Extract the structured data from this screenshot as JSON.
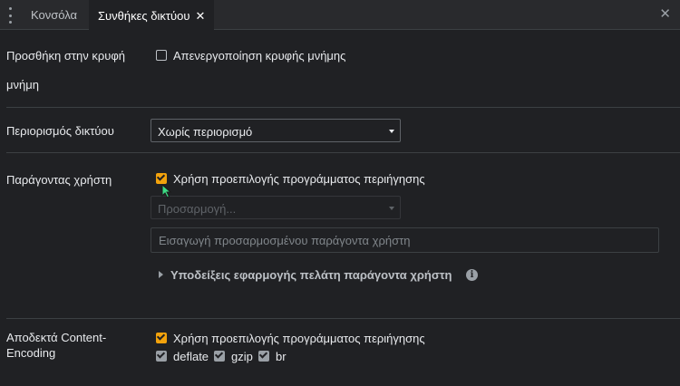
{
  "tabs": [
    {
      "label": "Κονσόλα",
      "active": false
    },
    {
      "label": "Συνθήκες δικτύου",
      "active": true
    }
  ],
  "tab_close_glyph": "✕",
  "drawer_close_glyph": "✕",
  "caching": {
    "label_line1": "Προσθήκη στην κρυφή",
    "label_line2": "μνήμη",
    "disable_cache_label": "Απενεργοποίηση κρυφής μνήμης",
    "disable_cache_checked": false
  },
  "throttling": {
    "label": "Περιορισμός δικτύου",
    "selected": "Χωρίς περιορισμό"
  },
  "user_agent": {
    "label": "Παράγοντας χρήστη",
    "use_default_label": "Χρήση προεπιλογής προγράμματος περιήγησης",
    "use_default_checked": true,
    "custom_select_value": "Προσαρμογή...",
    "custom_input_placeholder": "Εισαγωγή προσαρμοσμένου παράγοντα χρήστη",
    "client_hints_label": "Υποδείξεις εφαρμογής πελάτη παράγοντα χρήστη",
    "info_glyph": "i"
  },
  "content_encoding": {
    "label_line1": "Αποδεκτά Content-",
    "label_line2": "Encoding",
    "use_default_label": "Χρήση προεπιλογής προγράμματος περιήγησης",
    "use_default_checked": true,
    "encodings": [
      {
        "label": "deflate",
        "checked": true
      },
      {
        "label": "gzip",
        "checked": true
      },
      {
        "label": "br",
        "checked": true
      }
    ]
  },
  "colors": {
    "accent": "#f2a20c",
    "background": "#202124",
    "tabbar": "#292a2d"
  }
}
